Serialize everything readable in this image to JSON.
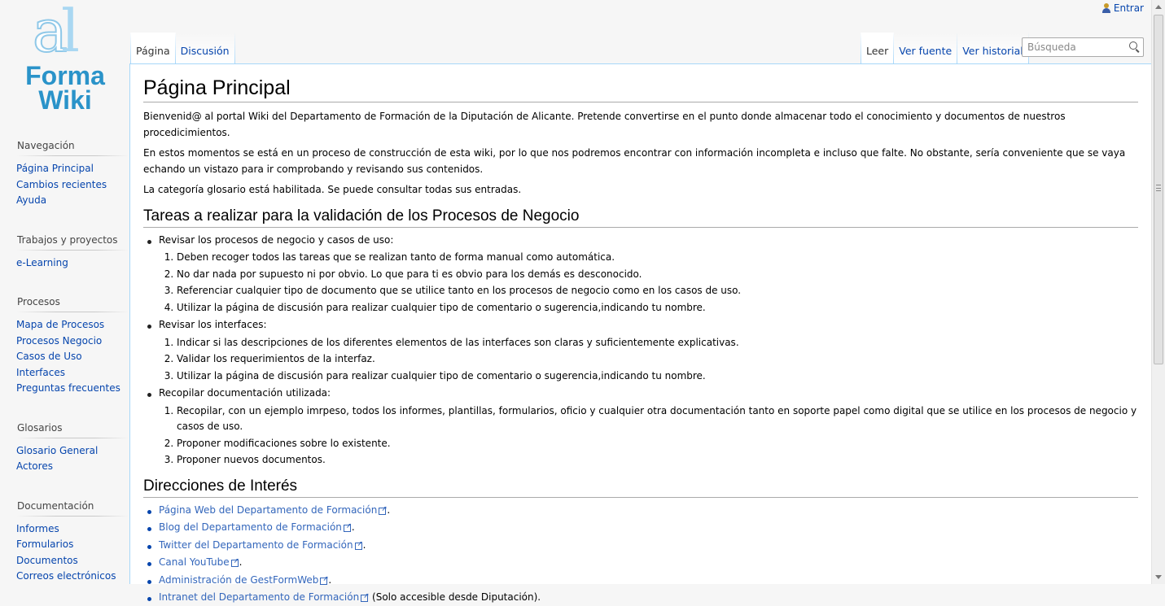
{
  "personal": {
    "login_label": "Entrar"
  },
  "logo": {
    "line1": "Forma",
    "line2": "Wiki"
  },
  "tabs": {
    "left": [
      "Página",
      "Discusión"
    ],
    "right": [
      "Leer",
      "Ver fuente",
      "Ver historial"
    ]
  },
  "search": {
    "placeholder": "Búsqueda"
  },
  "sidebar": [
    {
      "heading": "Navegación",
      "items": [
        "Página Principal",
        "Cambios recientes",
        "Ayuda"
      ]
    },
    {
      "heading": "Trabajos y proyectos",
      "items": [
        "e-Learning"
      ]
    },
    {
      "heading": "Procesos",
      "items": [
        "Mapa de Procesos",
        "Procesos Negocio",
        "Casos de Uso",
        "Interfaces",
        "Preguntas frecuentes"
      ]
    },
    {
      "heading": "Glosarios",
      "items": [
        "Glosario General",
        "Actores"
      ]
    },
    {
      "heading": "Documentación",
      "items": [
        "Informes",
        "Formularios",
        "Documentos",
        "Correos electrónicos"
      ]
    }
  ],
  "content": {
    "title": "Página Principal",
    "intro": [
      "Bienvenid@ al portal Wiki del Departamento de Formación de la Diputación de Alicante. Pretende convertirse en el punto donde almacenar todo el conocimiento y documentos de nuestros procedicimientos.",
      "En estos momentos se está en un proceso de construcción de esta wiki, por lo que nos podremos encontrar con información incompleta e incluso que falte. No obstante, sería conveniente que se vaya echando un vistazo para ir comprobando y revisando sus contenidos.",
      "La categoría glosario está habilitada. Se puede consultar todas sus entradas."
    ],
    "tasks_heading": "Tareas a realizar para la validación de los Procesos de Negocio",
    "tasks": [
      {
        "label": "Revisar los procesos de negocio y casos de uso:",
        "steps": [
          "Deben recoger todos las tareas que se realizan tanto de forma manual como automática.",
          "No dar nada por supuesto ni por obvio. Lo que para ti es obvio para los demás es desconocido.",
          "Referenciar cualquier tipo de documento que se utilice tanto en los procesos de negocio como en los casos de uso.",
          "Utilizar la página de discusión para realizar cualquier tipo de comentario o sugerencia,indicando tu nombre."
        ]
      },
      {
        "label": "Revisar los interfaces:",
        "steps": [
          "Indicar si las descripciones de los diferentes elementos de las interfaces son claras y suficientemente explicativas.",
          "Validar los requerimientos de la interfaz.",
          "Utilizar la página de discusión para realizar cualquier tipo de comentario o sugerencia,indicando tu nombre."
        ]
      },
      {
        "label": "Recopilar documentación utilizada:",
        "steps": [
          "Recopilar, con un ejemplo imrpeso, todos los informes, plantillas, formularios, oficio y cualquier otra documentación tanto en soporte papel como digital que se utilice en los procesos de negocio y casos de uso.",
          "Proponer modificaciones sobre lo existente.",
          "Proponer nuevos documentos."
        ]
      }
    ],
    "links_heading": "Direcciones de Interés",
    "links": [
      {
        "text": "Página Web del Departamento de Formación",
        "suffix": "."
      },
      {
        "text": "Blog del Departamento de Formación",
        "suffix": "."
      },
      {
        "text": "Twitter del Departamento de Formación",
        "suffix": "."
      },
      {
        "text": "Canal YouTube",
        "suffix": "."
      },
      {
        "text": "Administración de GestFormWeb",
        "suffix": "."
      },
      {
        "text": "Intranet del Departamento de Formación",
        "suffix": " (Solo accesible desde Diputación)."
      }
    ]
  },
  "colors": {
    "link": "#0645ad",
    "external_link": "#3366bb",
    "tab_border": "#a7d7f9",
    "logo": "#2a93c9"
  }
}
